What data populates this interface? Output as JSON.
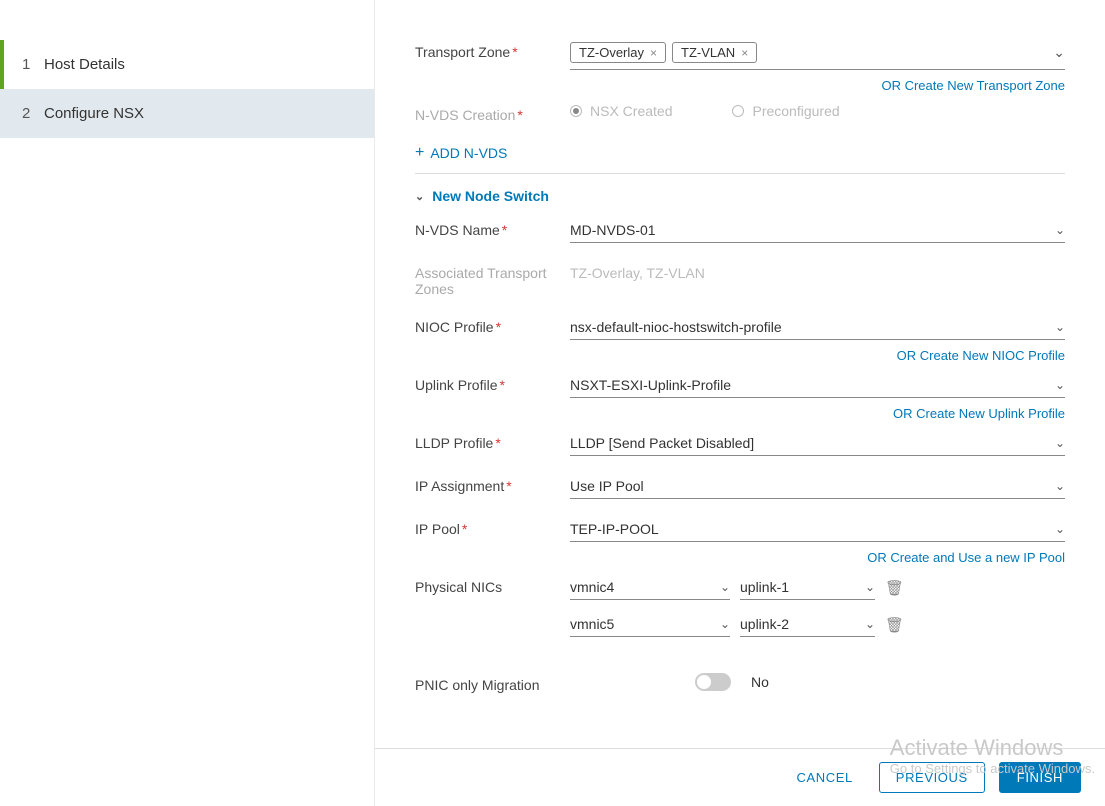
{
  "sidebar": {
    "steps": [
      {
        "num": "1",
        "label": "Host Details"
      },
      {
        "num": "2",
        "label": "Configure NSX"
      }
    ]
  },
  "labels": {
    "transport_zone": "Transport Zone",
    "nvds_creation": "N-VDS Creation",
    "add_nvds": "ADD N-VDS",
    "new_node_switch": "New Node Switch",
    "nvds_name": "N-VDS Name",
    "assoc_tz": "Associated Transport Zones",
    "nioc_profile": "NIOC Profile",
    "uplink_profile": "Uplink Profile",
    "lldp_profile": "LLDP Profile",
    "ip_assignment": "IP Assignment",
    "ip_pool": "IP Pool",
    "physical_nics": "Physical NICs",
    "pnic_only": "PNIC only Migration"
  },
  "transport_zone": {
    "tags": [
      "TZ-Overlay",
      "TZ-VLAN"
    ],
    "or_link": "OR Create New Transport Zone"
  },
  "nvds_creation": {
    "opt1": "NSX Created",
    "opt2": "Preconfigured"
  },
  "switch": {
    "nvds_name": "MD-NVDS-01",
    "assoc_tz": "TZ-Overlay, TZ-VLAN",
    "nioc_profile": "nsx-default-nioc-hostswitch-profile",
    "nioc_link": "OR Create New NIOC Profile",
    "uplink_profile": "NSXT-ESXI-Uplink-Profile",
    "uplink_link": "OR Create New Uplink Profile",
    "lldp_profile": "LLDP [Send Packet Disabled]",
    "ip_assignment": "Use IP Pool",
    "ip_pool": "TEP-IP-POOL",
    "ip_pool_link": "OR Create and Use a new IP Pool",
    "nics": [
      {
        "nic": "vmnic4",
        "uplink": "uplink-1"
      },
      {
        "nic": "vmnic5",
        "uplink": "uplink-2"
      }
    ],
    "pnic_only": "No"
  },
  "footer": {
    "cancel": "CANCEL",
    "previous": "PREVIOUS",
    "finish": "FINISH"
  },
  "watermark": {
    "big": "Activate Windows",
    "small": "Go to Settings to activate Windows."
  }
}
